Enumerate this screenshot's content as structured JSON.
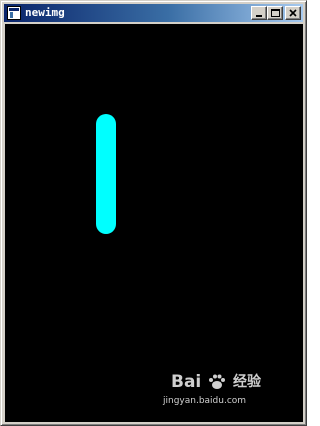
{
  "window": {
    "title": "newimg",
    "icon": "app-window-icon",
    "buttons": {
      "minimize": "minimize-icon",
      "maximize": "maximize-icon",
      "close": "close-icon"
    }
  },
  "canvas": {
    "background": "#000000",
    "shape": {
      "type": "rounded-line",
      "color": "#00ffff"
    }
  },
  "watermark": {
    "logo_text": "Bai",
    "logo_icon": "paw-icon",
    "brand_text": "经验",
    "url": "jingyan.baidu.com"
  }
}
